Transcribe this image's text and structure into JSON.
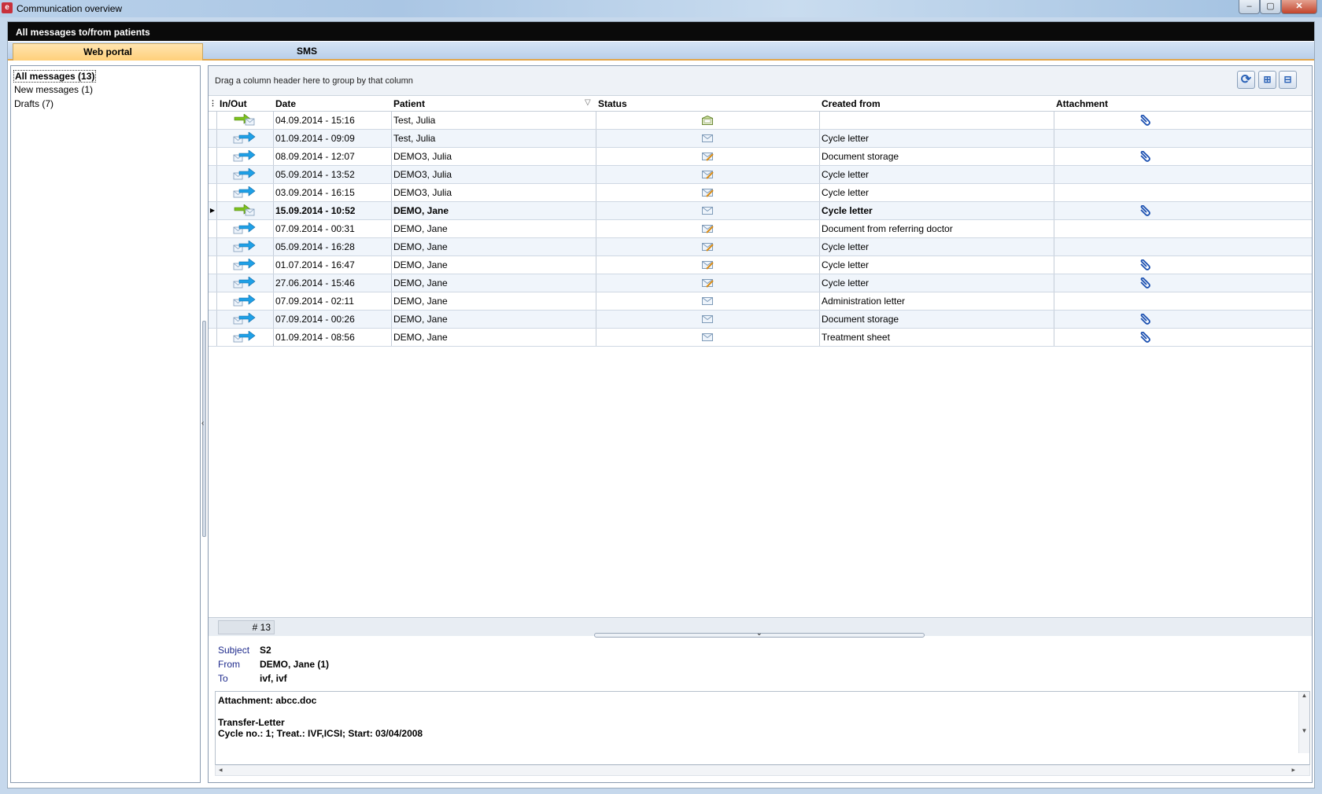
{
  "window": {
    "title": "Communication overview",
    "app_icon": "app-logo-icon",
    "controls": {
      "minimize": "–",
      "maximize": "▢",
      "close": "✕"
    }
  },
  "header": {
    "title": "All messages to/from patients"
  },
  "tabs": [
    {
      "label": "Web portal",
      "active": true
    },
    {
      "label": "SMS",
      "active": false
    }
  ],
  "folders": [
    {
      "label": "All messages (13)",
      "selected": true
    },
    {
      "label": "New messages (1)",
      "selected": false
    },
    {
      "label": "Drafts (7)",
      "selected": false
    }
  ],
  "grid": {
    "group_hint": "Drag a column header here to group by that column",
    "toolbar": {
      "refresh_icon": "refresh-icon",
      "expand_icon": "expand-all-icon",
      "collapse_icon": "collapse-all-icon"
    },
    "columns": [
      "In/Out",
      "Date",
      "Patient",
      "Status",
      "Created from",
      "Attachment"
    ],
    "rows": [
      {
        "direction": "in",
        "date": "04.09.2014 - 15:16",
        "patient": "Test, Julia",
        "status": "opened",
        "created_from": "",
        "attachment": true,
        "current": false
      },
      {
        "direction": "out",
        "date": "01.09.2014 - 09:09",
        "patient": "Test, Julia",
        "status": "sent",
        "created_from": "Cycle letter",
        "attachment": false,
        "current": false
      },
      {
        "direction": "out",
        "date": "08.09.2014 - 12:07",
        "patient": "DEMO3, Julia",
        "status": "draft",
        "created_from": "Document storage",
        "attachment": true,
        "current": false
      },
      {
        "direction": "out",
        "date": "05.09.2014 - 13:52",
        "patient": "DEMO3, Julia",
        "status": "draft",
        "created_from": "Cycle letter",
        "attachment": false,
        "current": false
      },
      {
        "direction": "out",
        "date": "03.09.2014 - 16:15",
        "patient": "DEMO3, Julia",
        "status": "draft",
        "created_from": "Cycle letter",
        "attachment": false,
        "current": false
      },
      {
        "direction": "in",
        "date": "15.09.2014 - 10:52",
        "patient": "DEMO, Jane",
        "status": "sent",
        "created_from": "Cycle letter",
        "attachment": true,
        "current": true
      },
      {
        "direction": "out",
        "date": "07.09.2014 - 00:31",
        "patient": "DEMO, Jane",
        "status": "draft",
        "created_from": "Document from referring doctor",
        "attachment": false,
        "current": false
      },
      {
        "direction": "out",
        "date": "05.09.2014 - 16:28",
        "patient": "DEMO, Jane",
        "status": "draft",
        "created_from": "Cycle letter",
        "attachment": false,
        "current": false
      },
      {
        "direction": "out",
        "date": "01.07.2014 - 16:47",
        "patient": "DEMO, Jane",
        "status": "draft",
        "created_from": "Cycle letter",
        "attachment": true,
        "current": false
      },
      {
        "direction": "out",
        "date": "27.06.2014 - 15:46",
        "patient": "DEMO, Jane",
        "status": "draft",
        "created_from": "Cycle letter",
        "attachment": true,
        "current": false
      },
      {
        "direction": "out",
        "date": "07.09.2014 - 02:11",
        "patient": "DEMO, Jane",
        "status": "sent",
        "created_from": "Administration letter",
        "attachment": false,
        "current": false
      },
      {
        "direction": "out",
        "date": "07.09.2014 - 00:26",
        "patient": "DEMO, Jane",
        "status": "sent",
        "created_from": "Document storage",
        "attachment": true,
        "current": false
      },
      {
        "direction": "out",
        "date": "01.09.2014 - 08:56",
        "patient": "DEMO, Jane",
        "status": "sent",
        "created_from": "Treatment sheet",
        "attachment": true,
        "current": false
      }
    ],
    "footer_count": "# 13"
  },
  "detail": {
    "subject_label": "Subject",
    "subject": "S2",
    "from_label": "From",
    "from": "DEMO, Jane (1)",
    "to_label": "To",
    "to": "ivf, ivf",
    "body_lines": [
      "Attachment: abcc.doc",
      "",
      "Transfer-Letter",
      "Cycle no.: 1; Treat.: IVF,ICSI; Start: 03/04/2008"
    ]
  },
  "colors": {
    "header_bg": "#0a0a0a",
    "tab_active": "#ffd07a",
    "arrow_in": "#7cc21d",
    "arrow_out": "#1fa0e6"
  }
}
